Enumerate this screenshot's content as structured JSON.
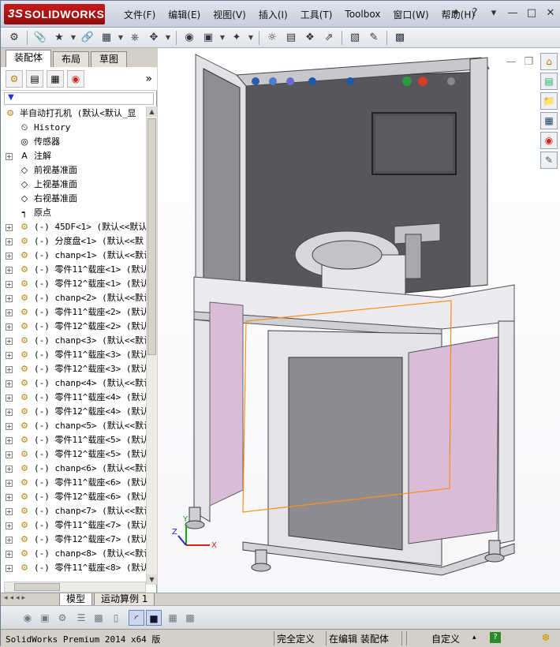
{
  "brand": {
    "ds": "3S",
    "name": "SOLIDWORKS"
  },
  "menu": [
    "文件(F)",
    "编辑(E)",
    "视图(V)",
    "插入(I)",
    "工具(T)",
    "Toolbox",
    "窗口(W)",
    "帮助(H)"
  ],
  "window_controls": {
    "pin": "✦",
    "help": "?",
    "dd": "▾",
    "min": "—",
    "max": "□",
    "close": "✕"
  },
  "panel_tabs": [
    "装配体",
    "布局",
    "草图"
  ],
  "panel_chevron": "»",
  "filter_icon": "▼",
  "tree": {
    "root": "半自动打孔机  (默认<默认_显",
    "fixed": [
      {
        "label": "History",
        "icon": "history-icon"
      },
      {
        "label": "传感器",
        "icon": "sensor-icon"
      },
      {
        "label": "注解",
        "icon": "annotation-icon",
        "expandable": true
      },
      {
        "label": "前视基准面",
        "icon": "plane-icon"
      },
      {
        "label": "上视基准面",
        "icon": "plane-icon"
      },
      {
        "label": "右视基准面",
        "icon": "plane-icon"
      },
      {
        "label": "原点",
        "icon": "origin-icon"
      }
    ],
    "parts": [
      "(-) 45DF<1> (默认<<默认",
      "(-) 分度盘<1> (默认<<默",
      "(-) chanp<1> (默认<<默认",
      "(-) 零件11^载座<1> (默认",
      "(-) 零件12^载座<1> (默认",
      "(-) chanp<2> (默认<<默认",
      "(-) 零件11^载座<2> (默认",
      "(-) 零件12^载座<2> (默认",
      "(-) chanp<3> (默认<<默认",
      "(-) 零件11^载座<3> (默认",
      "(-) 零件12^载座<3> (默认",
      "(-) chanp<4> (默认<<默认",
      "(-) 零件11^载座<4> (默认",
      "(-) 零件12^载座<4> (默认",
      "(-) chanp<5> (默认<<默认",
      "(-) 零件11^载座<5> (默认",
      "(-) 零件12^载座<5> (默认",
      "(-) chanp<6> (默认<<默认",
      "(-) 零件11^载座<6> (默认",
      "(-) 零件12^载座<6> (默认",
      "(-) chanp<7> (默认<<默认",
      "(-) 零件11^载座<7> (默认",
      "(-) 零件12^载座<7> (默认",
      "(-) chanp<8> (默认<<默认",
      "(-) 零件11^载座<8> (默认"
    ]
  },
  "model_tabs": [
    "模型",
    "运动算例 1"
  ],
  "model_nav": "◂◂◂▸",
  "status": {
    "app": "SolidWorks Premium 2014 x64 版",
    "constraint": "完全定义",
    "mode": "在编辑 装配体",
    "units": "自定义",
    "units_arrow": "▴",
    "help": "?"
  },
  "triad": {
    "x": "X",
    "y": "Y",
    "z": "Z"
  },
  "colors": {
    "frame": "#e8e8ec",
    "panel_dark": "#56565c",
    "door_pink": "#d8bcd8",
    "door_gray": "#8c8c90",
    "sketch_orange": "#ff8c1a",
    "accent": "#1c5aa8"
  }
}
